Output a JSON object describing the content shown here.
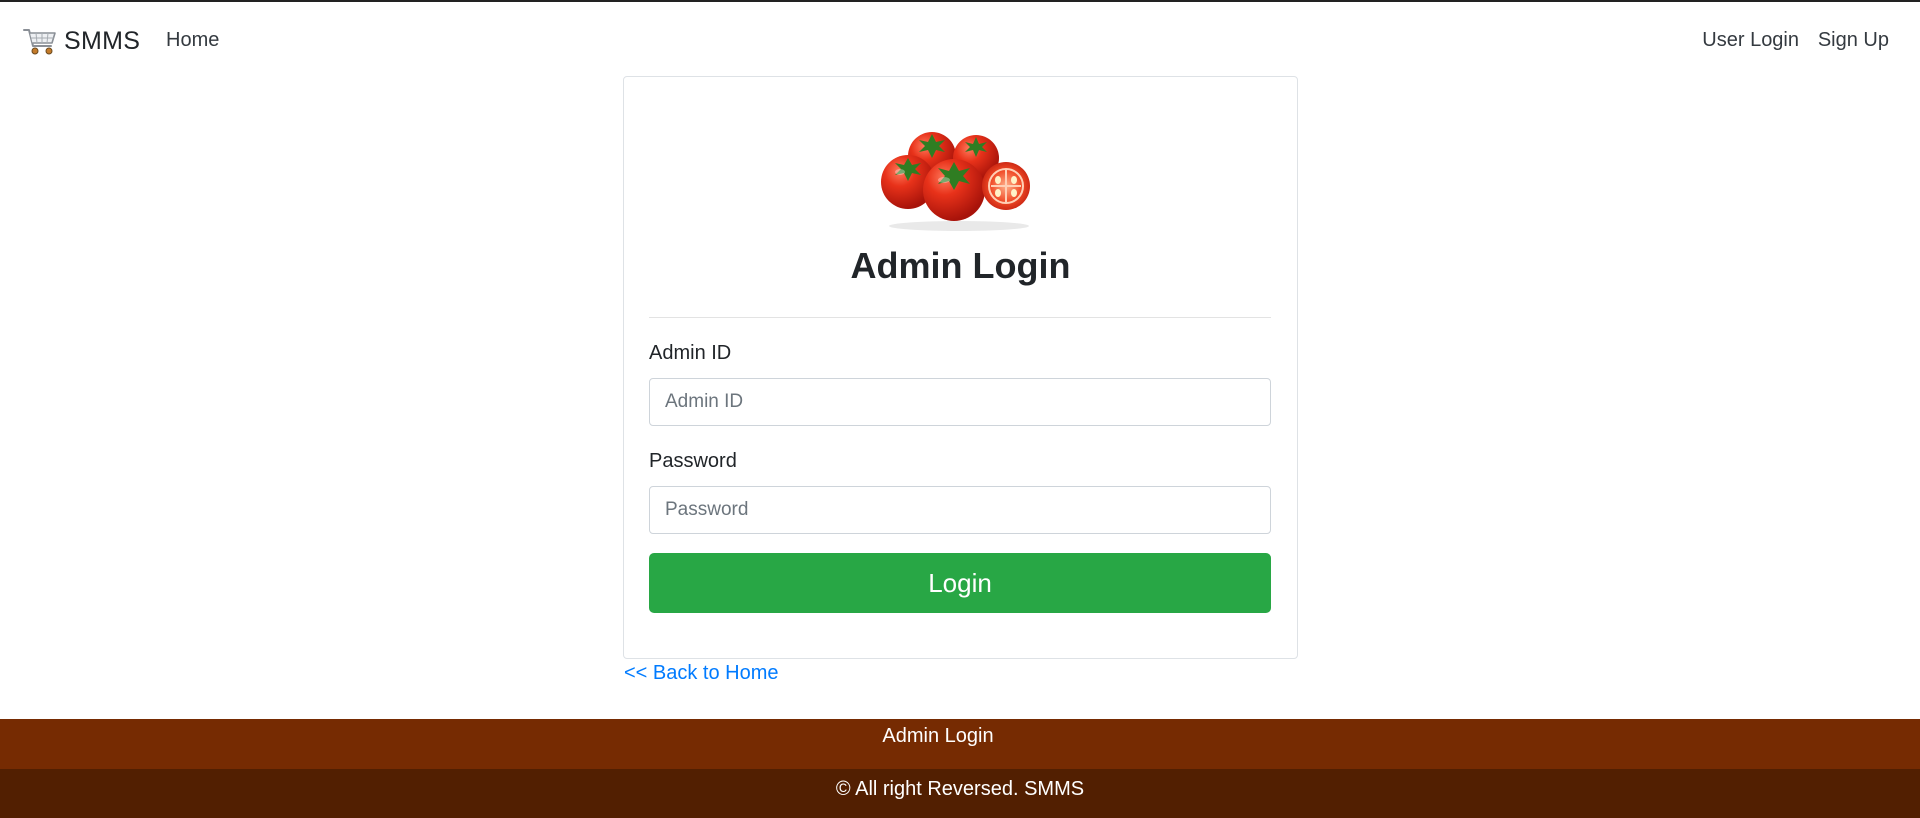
{
  "navbar": {
    "brand": "SMMS",
    "brand_icon": "shopping-cart-icon",
    "links": {
      "home": "Home",
      "user_login": "User Login",
      "sign_up": "Sign Up"
    }
  },
  "card": {
    "image_icon": "tomatoes-image",
    "title": "Admin Login",
    "admin_id": {
      "label": "Admin ID",
      "placeholder": "Admin ID",
      "value": ""
    },
    "password": {
      "label": "Password",
      "placeholder": "Password",
      "value": ""
    },
    "login_button": "Login"
  },
  "back_link": "<< Back to Home",
  "footer": {
    "page_name": "Admin Login",
    "copyright": "© All right Reversed. SMMS"
  },
  "colors": {
    "success": "#28a745",
    "link": "#007bff",
    "footer_top": "#762b02",
    "footer_bottom": "#521f01"
  }
}
